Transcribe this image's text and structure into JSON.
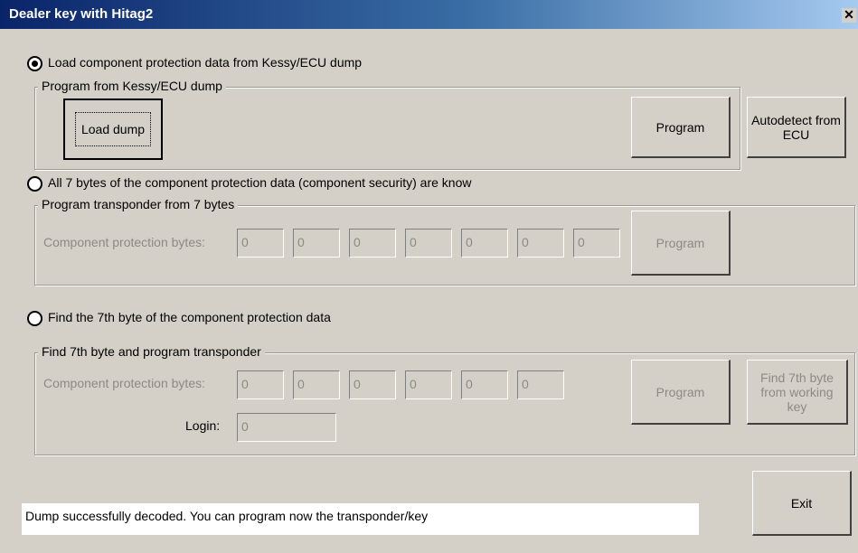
{
  "window": {
    "title": "Dealer key with Hitag2",
    "close_label": "✕"
  },
  "option1": {
    "label": "Load component protection data from Kessy/ECU dump",
    "group_title": "Program from Kessy/ECU dump",
    "load_dump": "Load dump",
    "program": "Program",
    "autodetect": "Autodetect from ECU"
  },
  "option2": {
    "label": "All 7 bytes of the component protection data (component security) are know",
    "group_title": "Program transponder from 7 bytes",
    "bytes_label": "Component protection bytes:",
    "bytes": [
      "0",
      "0",
      "0",
      "0",
      "0",
      "0",
      "0"
    ],
    "program": "Program"
  },
  "option3": {
    "label": "Find the 7th byte of the component protection data",
    "group_title": "Find 7th byte and program transponder",
    "bytes_label": "Component protection bytes:",
    "bytes": [
      "0",
      "0",
      "0",
      "0",
      "0",
      "0"
    ],
    "login_label": "Login:",
    "login_value": "0",
    "program": "Program",
    "find_7th": "Find 7th byte from working key"
  },
  "status_text": "Dump successfully decoded. You can program now the transponder/key",
  "exit_label": "Exit",
  "selected_option": 1
}
